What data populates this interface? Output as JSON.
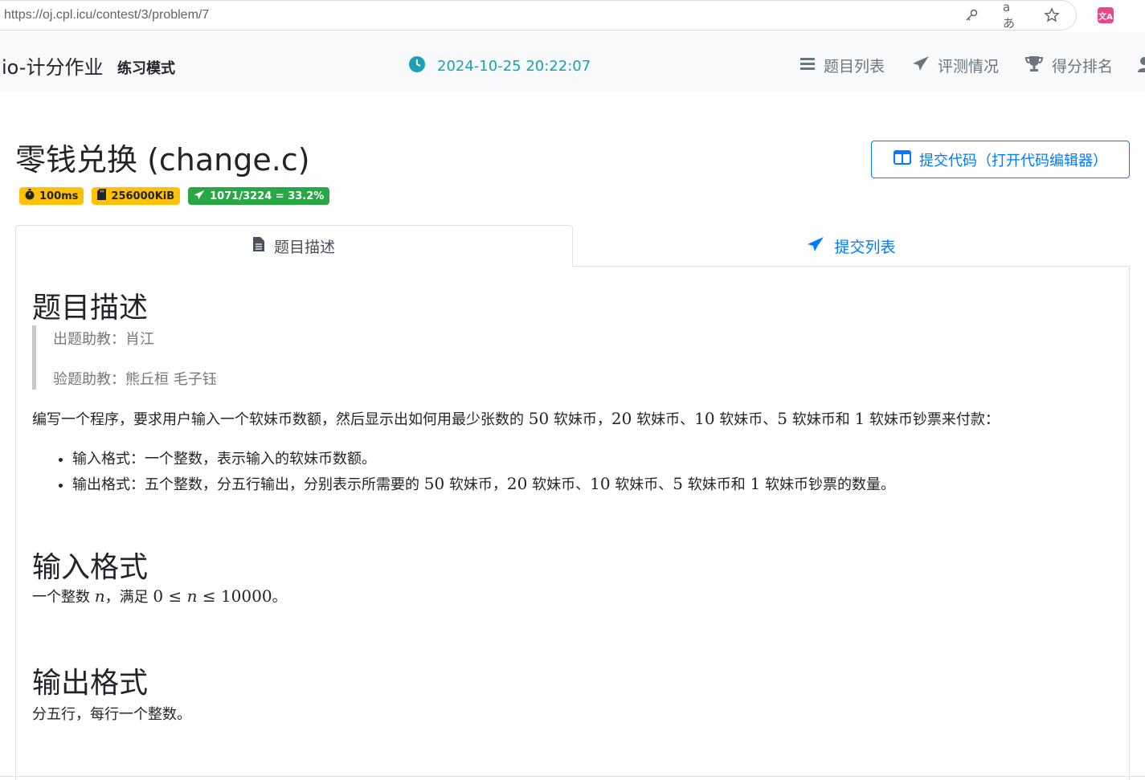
{
  "browser": {
    "url": "https://oj.cpl.icu/contest/3/problem/7"
  },
  "navbar": {
    "brand": "io-计分作业",
    "mode": "练习模式",
    "clock": "2024-10-25 20:22:07",
    "items": [
      {
        "label": "题目列表",
        "icon": "list-icon"
      },
      {
        "label": "评测情况",
        "icon": "paper-plane-icon"
      },
      {
        "label": "得分排名",
        "icon": "trophy-icon"
      }
    ]
  },
  "problem": {
    "title": "零钱兑换 (change.c)",
    "submit_button": "提交代码（打开代码编辑器）",
    "badges": {
      "time": "100ms",
      "memory": "256000KiB",
      "stats": "1071/3224 = 33.2%"
    },
    "tabs": [
      {
        "label": "题目描述",
        "icon": "file-icon",
        "active": true
      },
      {
        "label": "提交列表",
        "icon": "paper-plane-icon",
        "active": false
      }
    ]
  },
  "content": {
    "description_heading": "题目描述",
    "setter": "出题助教：肖江",
    "verifier": "验题助教：熊丘桓 毛子钰",
    "intro": {
      "part1": "编写一个程序，要求用户输入一个软妹币数额，然后显示出如何用最少张数的 ",
      "n50": "50",
      "part2": " 软妹币，",
      "n20": "20",
      "part3": " 软妹币、",
      "n10": "10",
      "part4": " 软妹币、",
      "n5": "5",
      "part5": " 软妹币和 ",
      "n1": "1",
      "part6": " 软妹币钞票来付款："
    },
    "bullets": {
      "b1": "输入格式：一个整数，表示输入的软妹币数额。",
      "b2_part1": "输出格式：五个整数，分五行输出，分别表示所需要的 ",
      "b2_n50": "50",
      "b2_part2": " 软妹币，",
      "b2_n20": "20",
      "b2_part3": " 软妹币、",
      "b2_n10": "10",
      "b2_part4": " 软妹币、",
      "b2_n5": "5",
      "b2_part5": " 软妹币和 ",
      "b2_n1": "1",
      "b2_part6": " 软妹币钞票的数量。"
    },
    "input_heading": "输入格式",
    "input_text": {
      "part1": "一个整数 ",
      "var": "n",
      "part2": "，满足 ",
      "low": "0",
      "le1": " ≤ ",
      "var2": "n",
      "le2": " ≤ ",
      "high": "10000",
      "part3": "。"
    },
    "output_heading": "输出格式",
    "output_text": "分五行，每行一个整数。"
  },
  "colors": {
    "primary": "#007bff",
    "info": "#17a2b8",
    "warning": "#ffc107",
    "success": "#28a745"
  }
}
